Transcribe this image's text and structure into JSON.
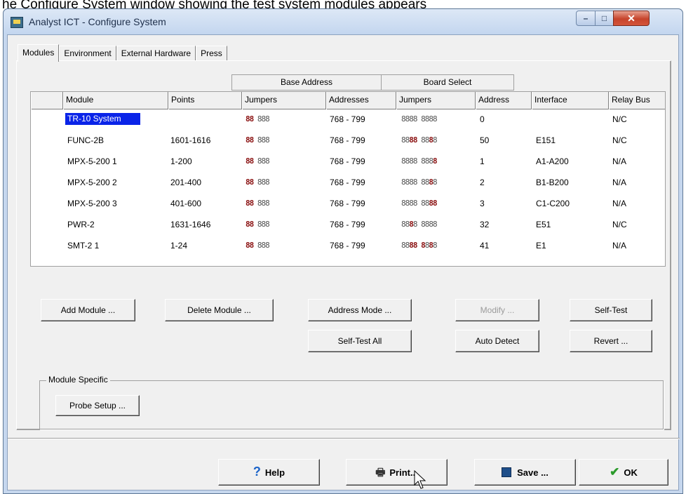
{
  "caption_strip": "he Configure System window showing the test system modules appears",
  "window": {
    "title": "Analyst ICT - Configure System",
    "controls": {
      "minimize": "–",
      "maximize": "□",
      "close": "✕"
    }
  },
  "tabs": [
    {
      "label": "Modules",
      "active": true
    },
    {
      "label": "Environment",
      "active": false
    },
    {
      "label": "External Hardware",
      "active": false
    },
    {
      "label": "Press",
      "active": false
    }
  ],
  "group_headers": {
    "base_address": "Base Address",
    "board_select": "Board Select"
  },
  "table": {
    "columns": [
      "Module",
      "Points",
      "Jumpers",
      "Addresses",
      "Jumpers",
      "Address",
      "Interface",
      "Relay Bus"
    ],
    "rows": [
      {
        "module": "TR-10 System",
        "points": "",
        "base_jumpers": "88 888",
        "addresses": "768 - 799",
        "board_jumpers": "8888 8888",
        "address": "0",
        "interface": "",
        "relay_bus": "N/C",
        "selected": true
      },
      {
        "module": "FUNC-2B",
        "points": "1601-1616",
        "base_jumpers": "88 888",
        "addresses": "768 - 799",
        "board_jumpers": "8888 8888",
        "address": "50",
        "interface": "E151",
        "relay_bus": "N/C",
        "selected": false
      },
      {
        "module": "MPX-5-200  1",
        "points": "1-200",
        "base_jumpers": "88 888",
        "addresses": "768 - 799",
        "board_jumpers": "8888 8888",
        "address": "1",
        "interface": "A1-A200",
        "relay_bus": "N/A",
        "selected": false
      },
      {
        "module": "MPX-5-200  2",
        "points": "201-400",
        "base_jumpers": "88 888",
        "addresses": "768 - 799",
        "board_jumpers": "8888 8888",
        "address": "2",
        "interface": "B1-B200",
        "relay_bus": "N/A",
        "selected": false
      },
      {
        "module": "MPX-5-200  3",
        "points": "401-600",
        "base_jumpers": "88 888",
        "addresses": "768 - 799",
        "board_jumpers": "8888 8888",
        "address": "3",
        "interface": "C1-C200",
        "relay_bus": "N/A",
        "selected": false
      },
      {
        "module": "PWR-2",
        "points": "1631-1646",
        "base_jumpers": "88 888",
        "addresses": "768 - 799",
        "board_jumpers": "8888 8888",
        "address": "32",
        "interface": "E51",
        "relay_bus": "N/C",
        "selected": false
      },
      {
        "module": "SMT-2  1",
        "points": "1-24",
        "base_jumpers": "88 888",
        "addresses": "768 - 799",
        "board_jumpers": "8888 8888",
        "address": "41",
        "interface": "E1",
        "relay_bus": "N/A",
        "selected": false
      }
    ]
  },
  "buttons": {
    "add_module": "Add Module ...",
    "delete_module": "Delete Module ...",
    "address_mode": "Address Mode ...",
    "modify": "Modify ...",
    "self_test": "Self-Test",
    "self_test_all": "Self-Test All",
    "auto_detect": "Auto Detect",
    "revert": "Revert ..."
  },
  "module_specific": {
    "label": "Module Specific",
    "probe_setup": "Probe Setup ..."
  },
  "footer": {
    "help": "Help",
    "print": "Print...",
    "save": "Save ...",
    "ok": "OK"
  },
  "icons": {
    "help": "question-mark-icon",
    "print": "printer-icon",
    "save": "floppy-disk-icon",
    "ok": "checkmark-icon"
  },
  "colors": {
    "selection": "#0a24e8",
    "jumper_on": "#8b1212",
    "help_icon": "#1b63c9",
    "ok_icon": "#2a9a2a"
  }
}
